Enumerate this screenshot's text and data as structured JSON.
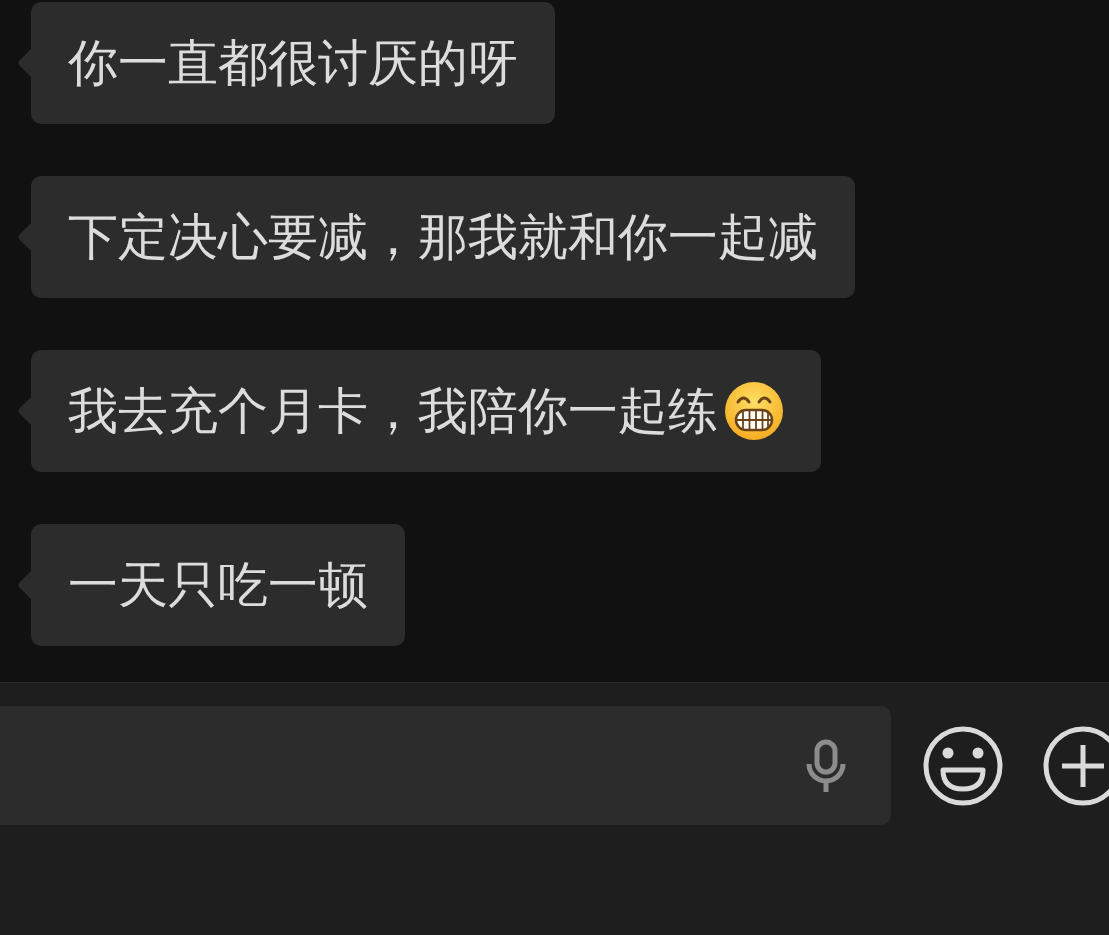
{
  "messages": [
    {
      "text": "你一直都很讨厌的呀",
      "emoji": false
    },
    {
      "text": "下定决心要减，那我就和你一起减",
      "emoji": false
    },
    {
      "text": "我去充个月卡，我陪你一起练",
      "emoji": true
    },
    {
      "text": "一天只吃一顿",
      "emoji": false
    }
  ]
}
